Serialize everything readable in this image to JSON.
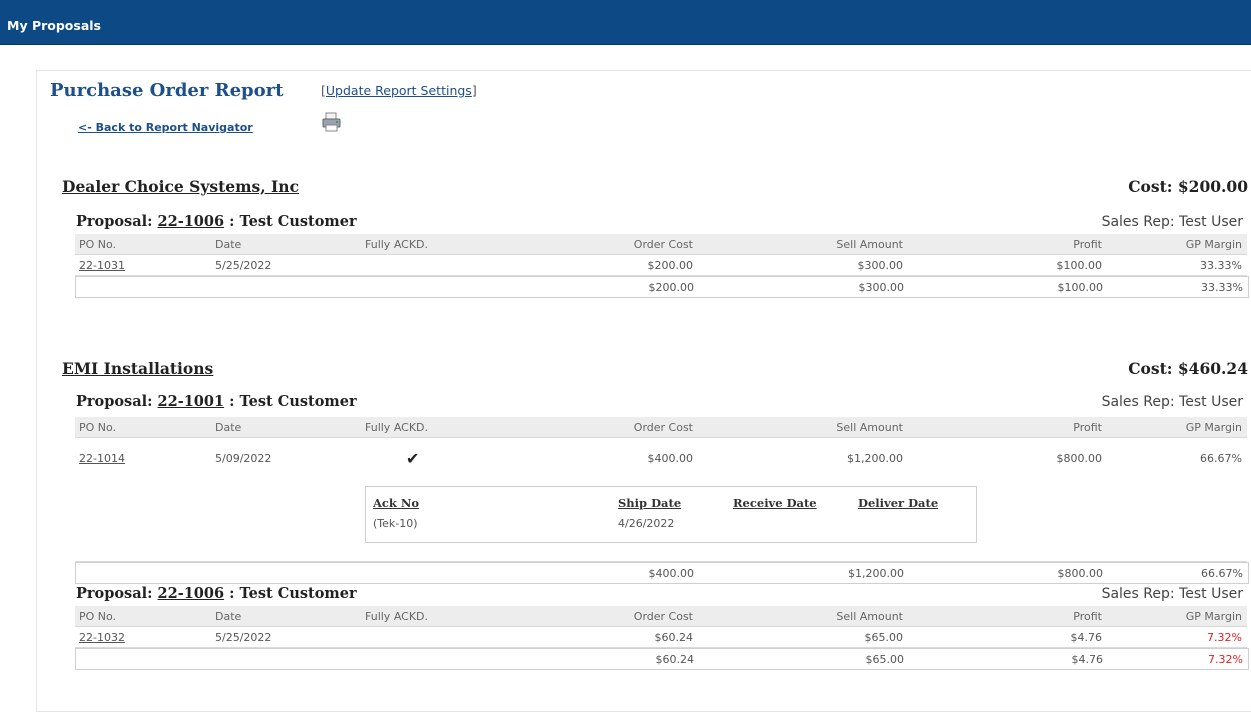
{
  "app": {
    "title": "My Proposals"
  },
  "report": {
    "title": "Purchase Order Report",
    "settings_open": "[",
    "settings_link": "Update Report Settings",
    "settings_close": "]",
    "back_link": "<- Back to Report Navigator",
    "print_icon": "printer-icon"
  },
  "columns": {
    "po": "PO No.",
    "date": "Date",
    "ack": "Fully ACKD.",
    "cost": "Order Cost",
    "sell": "Sell Amount",
    "profit": "Profit",
    "gp": "GP Margin"
  },
  "vendors": [
    {
      "name": "Dealer Choice Systems, Inc",
      "cost": "Cost: $200.00",
      "proposals": [
        {
          "label": "Proposal:",
          "number": "22-1006",
          "customer": ": Test Customer",
          "sales_rep": "Sales Rep: Test User",
          "rows": [
            {
              "po": "22-1031",
              "date": "5/25/2022",
              "cost": "$200.00",
              "sell": "$300.00",
              "profit": "$100.00",
              "gp": "33.33%"
            }
          ],
          "total": {
            "cost": "$200.00",
            "sell": "$300.00",
            "profit": "$100.00",
            "gp": "33.33%"
          }
        }
      ]
    },
    {
      "name": "EMI Installations",
      "cost": "Cost: $460.24",
      "proposals": [
        {
          "label": "Proposal:",
          "number": "22-1001",
          "customer": ": Test Customer",
          "sales_rep": "Sales Rep: Test User",
          "rows": [
            {
              "po": "22-1014",
              "date": "5/09/2022",
              "ack_check": "✔",
              "cost": "$400.00",
              "sell": "$1,200.00",
              "profit": "$800.00",
              "gp": "66.67%"
            }
          ],
          "ack_detail": {
            "headers": {
              "ack_no": "Ack No",
              "ship_date": "Ship Date",
              "receive_date": "Receive Date",
              "deliver_date": "Deliver Date"
            },
            "values": {
              "ack_no": "(Tek-10)",
              "ship_date": "4/26/2022"
            }
          },
          "total": {
            "cost": "$400.00",
            "sell": "$1,200.00",
            "profit": "$800.00",
            "gp": "66.67%"
          }
        },
        {
          "label": "Proposal:",
          "number": "22-1006",
          "customer": ": Test Customer",
          "sales_rep": "Sales Rep: Test User",
          "rows": [
            {
              "po": "22-1032",
              "date": "5/25/2022",
              "cost": "$60.24",
              "sell": "$65.00",
              "profit": "$4.76",
              "gp": "7.32%"
            }
          ],
          "total": {
            "cost": "$60.24",
            "sell": "$65.00",
            "profit": "$4.76",
            "gp": "7.32%"
          }
        }
      ]
    }
  ],
  "colors": {
    "header_bar": "#0d4a85",
    "title": "#1d4f8a",
    "negative_margin": "#dd2222"
  }
}
